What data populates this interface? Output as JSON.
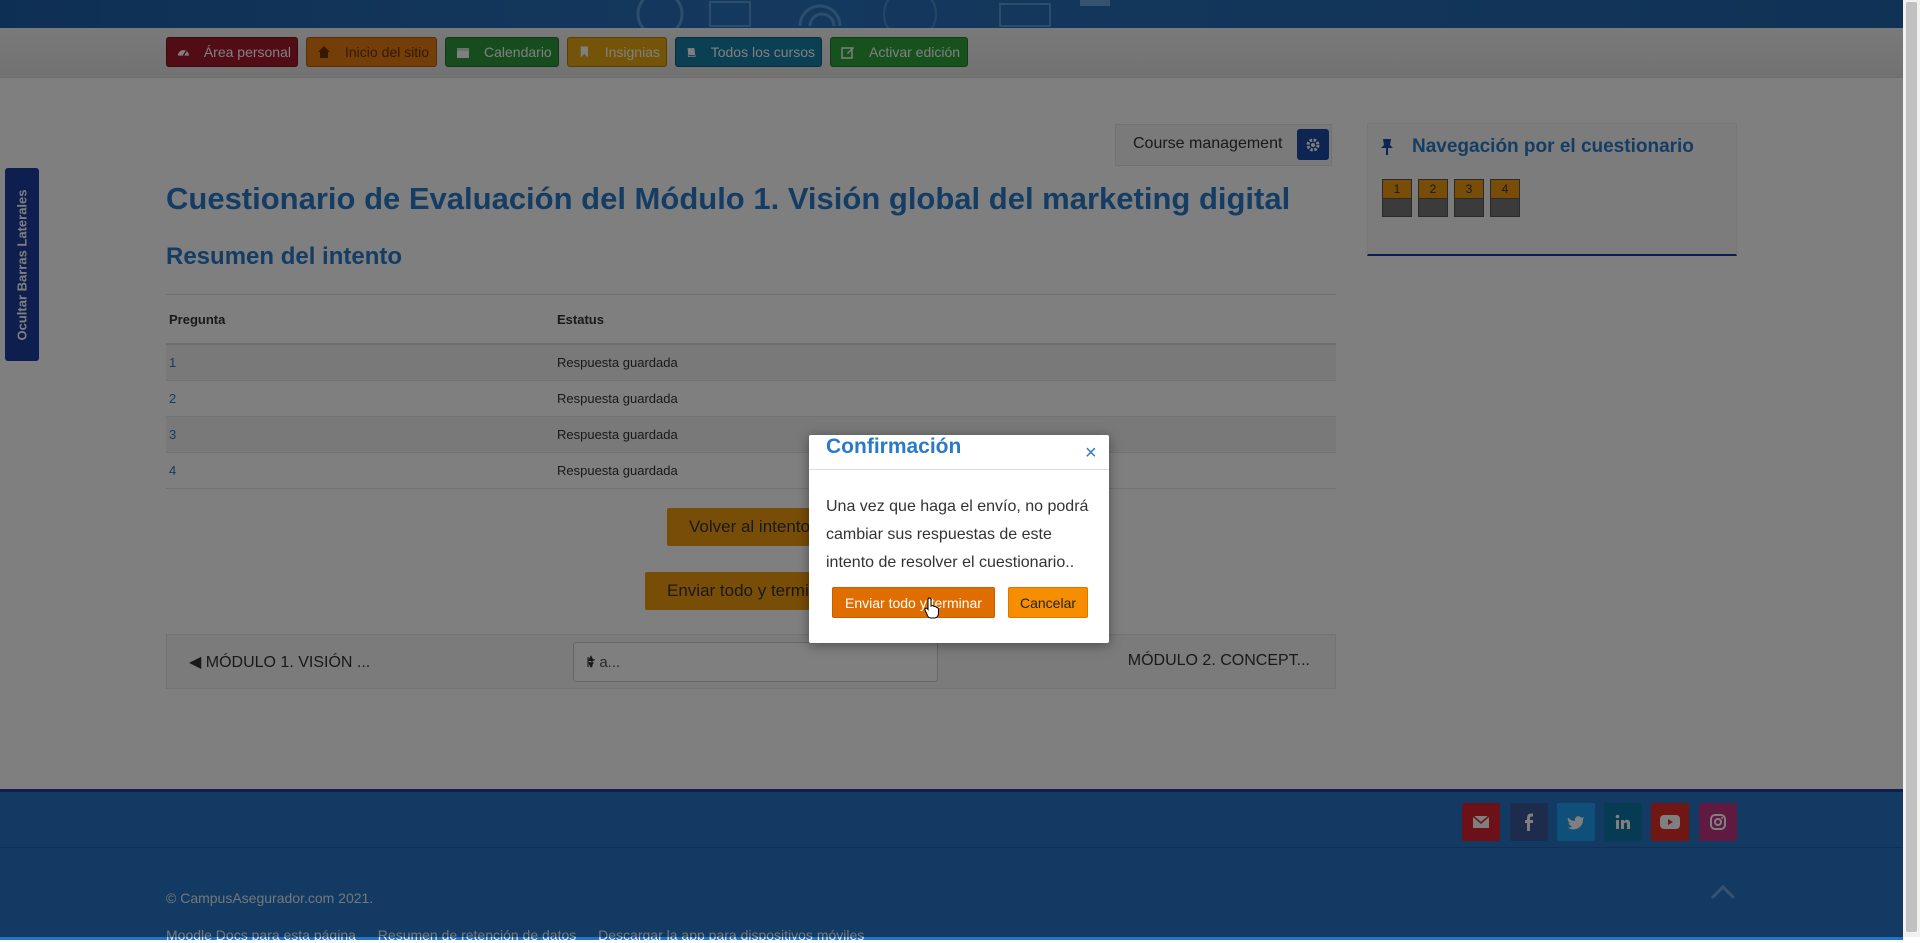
{
  "nav": {
    "items": [
      {
        "label": "Área personal",
        "icon": "dashboard-icon",
        "color": "#a5182b"
      },
      {
        "label": "Inicio del sitio",
        "icon": "home-icon",
        "color": "#e97c12"
      },
      {
        "label": "Calendario",
        "icon": "calendar-icon",
        "color": "#2e9a3c"
      },
      {
        "label": "Insignias",
        "icon": "bookmark-icon",
        "color": "#e8a812"
      },
      {
        "label": "Todos los cursos",
        "icon": "book-icon",
        "color": "#177ea6"
      },
      {
        "label": "Activar edición",
        "icon": "edit-icon",
        "color": "#2fa33c"
      }
    ]
  },
  "sidebar_toggle": {
    "label": "Ocultar Barras Laterales"
  },
  "course_management": {
    "label": "Course management",
    "icon": "gear-icon"
  },
  "page": {
    "title": "Cuestionario de Evaluación del Módulo 1. Visión global del marketing digital",
    "subtitle": "Resumen del intento"
  },
  "summary": {
    "headers": [
      "Pregunta",
      "Estatus"
    ],
    "rows": [
      {
        "question": "1",
        "status": "Respuesta guardada"
      },
      {
        "question": "2",
        "status": "Respuesta guardada"
      },
      {
        "question": "3",
        "status": "Respuesta guardada"
      },
      {
        "question": "4",
        "status": "Respuesta guardada"
      }
    ]
  },
  "actions": {
    "return_label": "Volver al intento",
    "submit_label": "Enviar todo y terminar"
  },
  "activity_nav": {
    "prev_label": "◀ MÓDULO 1. VISIÓN ...",
    "jump_placeholder": "Ir a...",
    "next_label": "MÓDULO 2. CONCEPT..."
  },
  "quiz_nav": {
    "title": "Navegación por el cuestionario",
    "buttons": [
      "1",
      "2",
      "3",
      "4"
    ]
  },
  "footer": {
    "copyright": "© CampusAsegurador.com 2021.",
    "links": [
      "Moodle Docs para esta página",
      "Resumen de retención de datos",
      "Descargar la app para dispositivos móviles"
    ],
    "social": [
      {
        "icon": "email-icon",
        "color": "#d9232e"
      },
      {
        "icon": "facebook-icon",
        "color": "#3b5998"
      },
      {
        "icon": "twitter-icon",
        "color": "#1da1f2"
      },
      {
        "icon": "linkedin-icon",
        "color": "#0e76a8"
      },
      {
        "icon": "youtube-icon",
        "color": "#e52d27"
      },
      {
        "icon": "instagram-icon",
        "color": "#c13584"
      }
    ]
  },
  "modal": {
    "title": "Confirmación",
    "body": "Una vez que haga el envío, no podrá cambiar sus respuestas de este intento de resolver el cuestionario..",
    "confirm_label": "Enviar todo y terminar",
    "cancel_label": "Cancelar"
  }
}
